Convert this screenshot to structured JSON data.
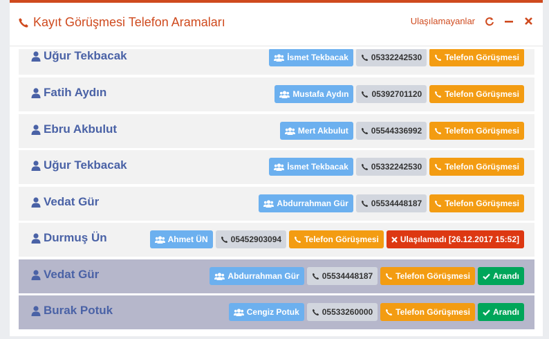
{
  "header": {
    "title": "Kayıt Görüşmesi Telefon Aramaları",
    "unreachable_link": "Ulaşılamayanlar",
    "accent_color": "#cf4a1e"
  },
  "rows": [
    {
      "name": "Uğur Tekbacak",
      "contact": "İsmet Tekbacak",
      "phone": "05332242530",
      "action": "Telefon Görüşmesi"
    },
    {
      "name": "Fatih Aydın",
      "contact": "Mustafa Aydın",
      "phone": "05392701120",
      "action": "Telefon Görüşmesi"
    },
    {
      "name": "Ebru Akbulut",
      "contact": "Mert Akbulut",
      "phone": "05544336992",
      "action": "Telefon Görüşmesi"
    },
    {
      "name": "Uğur Tekbacak",
      "contact": "İsmet Tekbacak",
      "phone": "05332242530",
      "action": "Telefon Görüşmesi"
    },
    {
      "name": "Vedat Gür",
      "contact": "Abdurrahman Gür",
      "phone": "05534448187",
      "action": "Telefon Görüşmesi"
    },
    {
      "name": "Durmuş Ün",
      "contact": "Ahmet ÜN",
      "phone": "05452903094",
      "action": "Telefon Görüşmesi",
      "status": "Ulaşılamadı [26.12.2017 15:52]"
    },
    {
      "name": "Vedat Gür",
      "contact": "Abdurrahman Gür",
      "phone": "05534448187",
      "action": "Telefon Görüşmesi",
      "status": "Arandı"
    },
    {
      "name": "Burak Potuk",
      "contact": "Cengiz Potuk",
      "phone": "05533260000",
      "action": "Telefon Görüşmesi",
      "status": "Arandı"
    }
  ]
}
